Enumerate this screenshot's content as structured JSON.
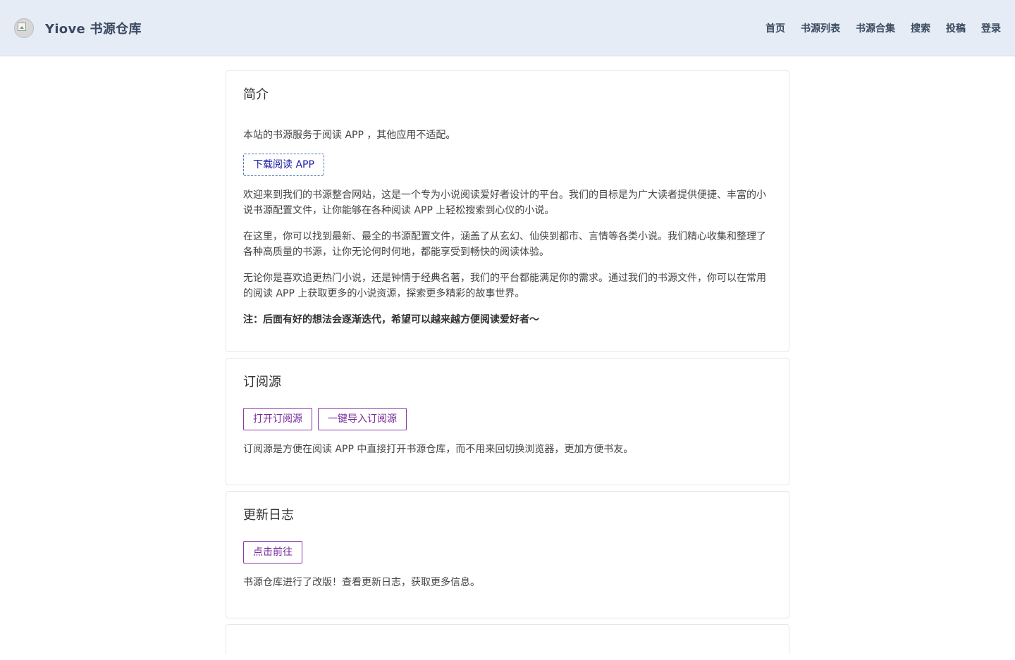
{
  "header": {
    "brand_title": "Yiove 书源仓库",
    "nav": [
      "首页",
      "书源列表",
      "书源合集",
      "搜索",
      "投稿",
      "登录"
    ]
  },
  "intro": {
    "title": "简介",
    "p1": "本站的书源服务于阅读 APP ，其他应用不适配。",
    "download_button": "下载阅读 APP",
    "p2": "欢迎来到我们的书源整合网站，这是一个专为小说阅读爱好者设计的平台。我们的目标是为广大读者提供便捷、丰富的小说书源配置文件，让你能够在各种阅读 APP 上轻松搜索到心仪的小说。",
    "p3": "在这里，你可以找到最新、最全的书源配置文件，涵盖了从玄幻、仙侠到都市、言情等各类小说。我们精心收集和整理了各种高质量的书源，让你无论何时何地，都能享受到畅快的阅读体验。",
    "p4": "无论你是喜欢追更热门小说，还是钟情于经典名著，我们的平台都能满足你的需求。通过我们的书源文件，你可以在常用的阅读 APP 上获取更多的小说资源，探索更多精彩的故事世界。",
    "note": "注：后面有好的想法会逐渐迭代，希望可以越来越方便阅读爱好者～"
  },
  "subscription": {
    "title": "订阅源",
    "open_button": "打开订阅源",
    "import_button": "一键导入订阅源",
    "desc": "订阅源是方便在阅读 APP 中直接打开书源仓库，而不用来回切换浏览器，更加方便书友。"
  },
  "changelog": {
    "title": "更新日志",
    "go_button": "点击前往",
    "desc": "书源仓库进行了改版！查看更新日志，获取更多信息。"
  }
}
